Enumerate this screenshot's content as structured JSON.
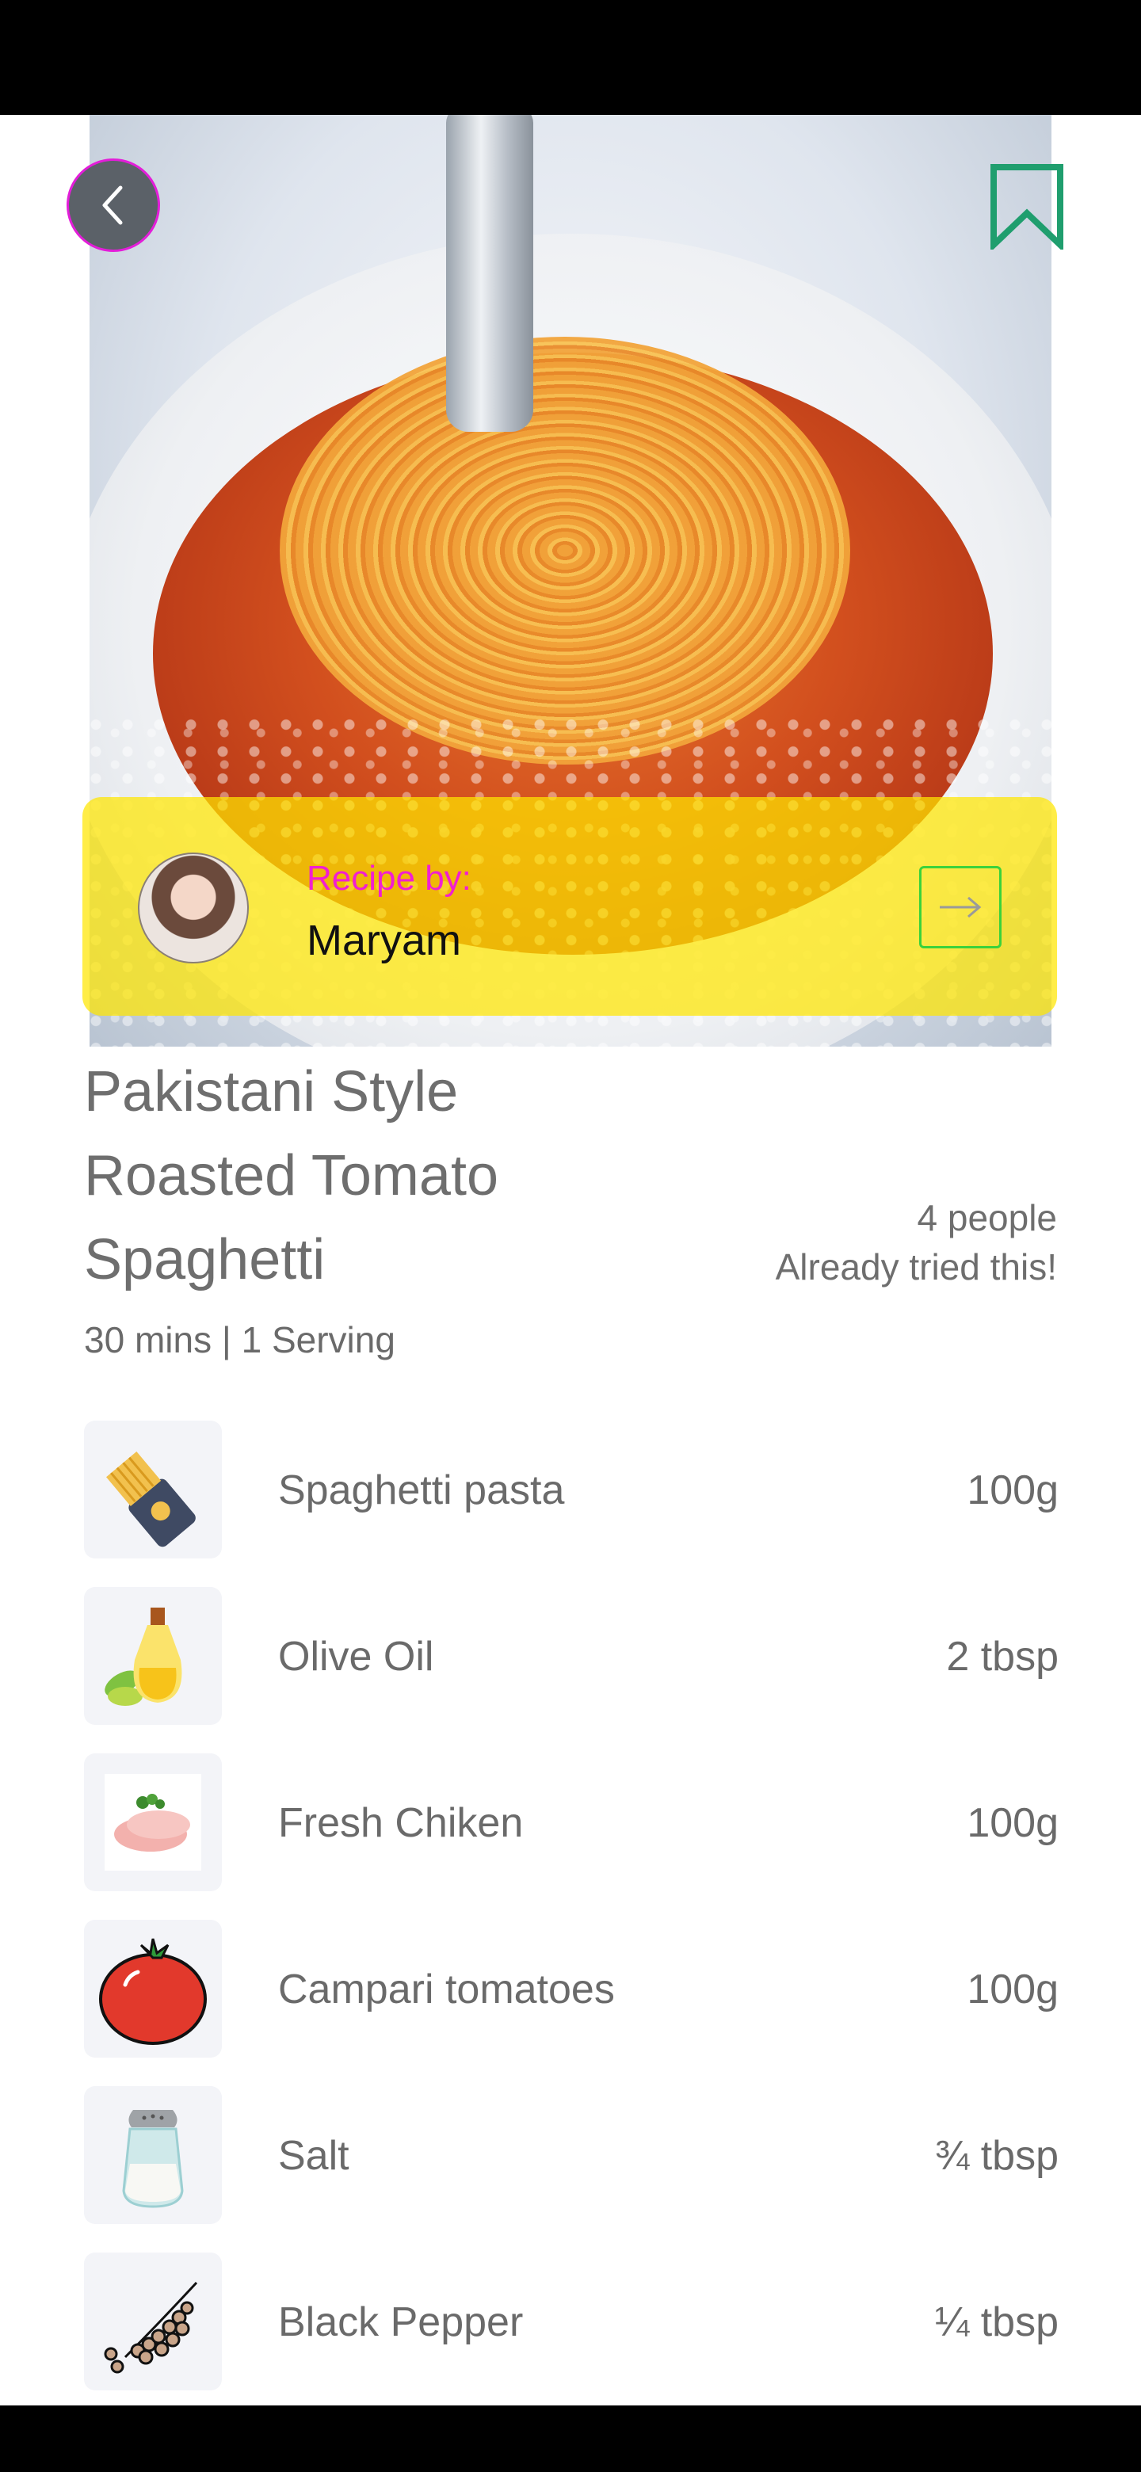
{
  "header": {
    "back_icon": "chevron-left-icon",
    "bookmark_icon": "bookmark-icon",
    "hero_image": "spaghetti-with-fork-photo"
  },
  "author": {
    "label": "Recipe by:",
    "name": "Maryam",
    "arrow_icon": "arrow-right-icon"
  },
  "recipe": {
    "title": "Pakistani Style Roasted Tomato Spaghetti",
    "meta": "30 mins | 1 Serving",
    "tried_count": "4 people",
    "tried_label": "Already tried this!"
  },
  "ingredients": [
    {
      "name": "Spaghetti pasta",
      "qty": "100g",
      "icon": "pasta-pack-icon"
    },
    {
      "name": "Olive Oil",
      "qty": "2 tbsp",
      "icon": "olive-oil-icon"
    },
    {
      "name": "Fresh Chiken",
      "qty": "100g",
      "icon": "chicken-icon"
    },
    {
      "name": "Campari tomatoes",
      "qty": "100g",
      "icon": "tomato-icon"
    },
    {
      "name": "Salt",
      "qty": "¾ tbsp",
      "icon": "salt-shaker-icon"
    },
    {
      "name": "Black Pepper",
      "qty": "¼ tbsp",
      "icon": "black-pepper-icon"
    }
  ],
  "colors": {
    "accent_magenta": "#f11fd1",
    "card_yellow": "#ffe600",
    "bookmark_green": "#1f9e6e",
    "arrow_green": "#3bd23b"
  }
}
